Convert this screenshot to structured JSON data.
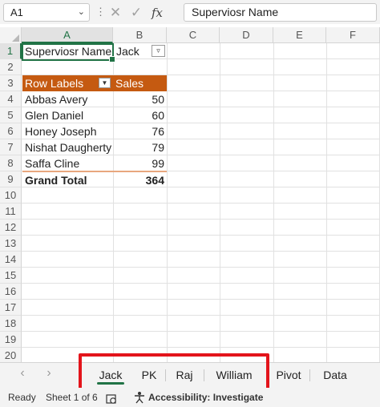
{
  "formula_bar": {
    "name_box": "A1",
    "dots": "⋮",
    "cancel_icon": "✕",
    "enter_icon": "✓",
    "fx_label": "fx",
    "formula": "Superviosr Name"
  },
  "columns": [
    "A",
    "B",
    "C",
    "D",
    "E",
    "F"
  ],
  "rows": [
    "1",
    "2",
    "3",
    "4",
    "5",
    "6",
    "7",
    "8",
    "9",
    "10",
    "11",
    "12",
    "13",
    "14",
    "15",
    "16",
    "17",
    "18",
    "19",
    "20"
  ],
  "cells": {
    "a1": "Superviosr Name",
    "b1": "Jack",
    "pivot": {
      "row_labels_header": "Row Labels",
      "values_header": "Sales",
      "items": [
        {
          "label": "Abbas Avery",
          "value": "50"
        },
        {
          "label": "Glen Daniel",
          "value": "60"
        },
        {
          "label": "Honey Joseph",
          "value": "76"
        },
        {
          "label": "Nishat Daugherty",
          "value": "79"
        },
        {
          "label": "Saffa Cline",
          "value": "99"
        }
      ],
      "grand_total_label": "Grand Total",
      "grand_total_value": "364"
    }
  },
  "sheet_tabs": [
    "Jack",
    "PK",
    "Raj",
    "William",
    "Pivot",
    "Data"
  ],
  "active_tab": "Jack",
  "nav": {
    "prev": "‹",
    "next": "›"
  },
  "status": {
    "ready": "Ready",
    "sheet_info": "Sheet 1 of 6",
    "accessibility": "Accessibility: Investigate"
  },
  "colors": {
    "accent": "#217346",
    "pivot_header": "#c55a11",
    "highlight": "#e3141b"
  }
}
